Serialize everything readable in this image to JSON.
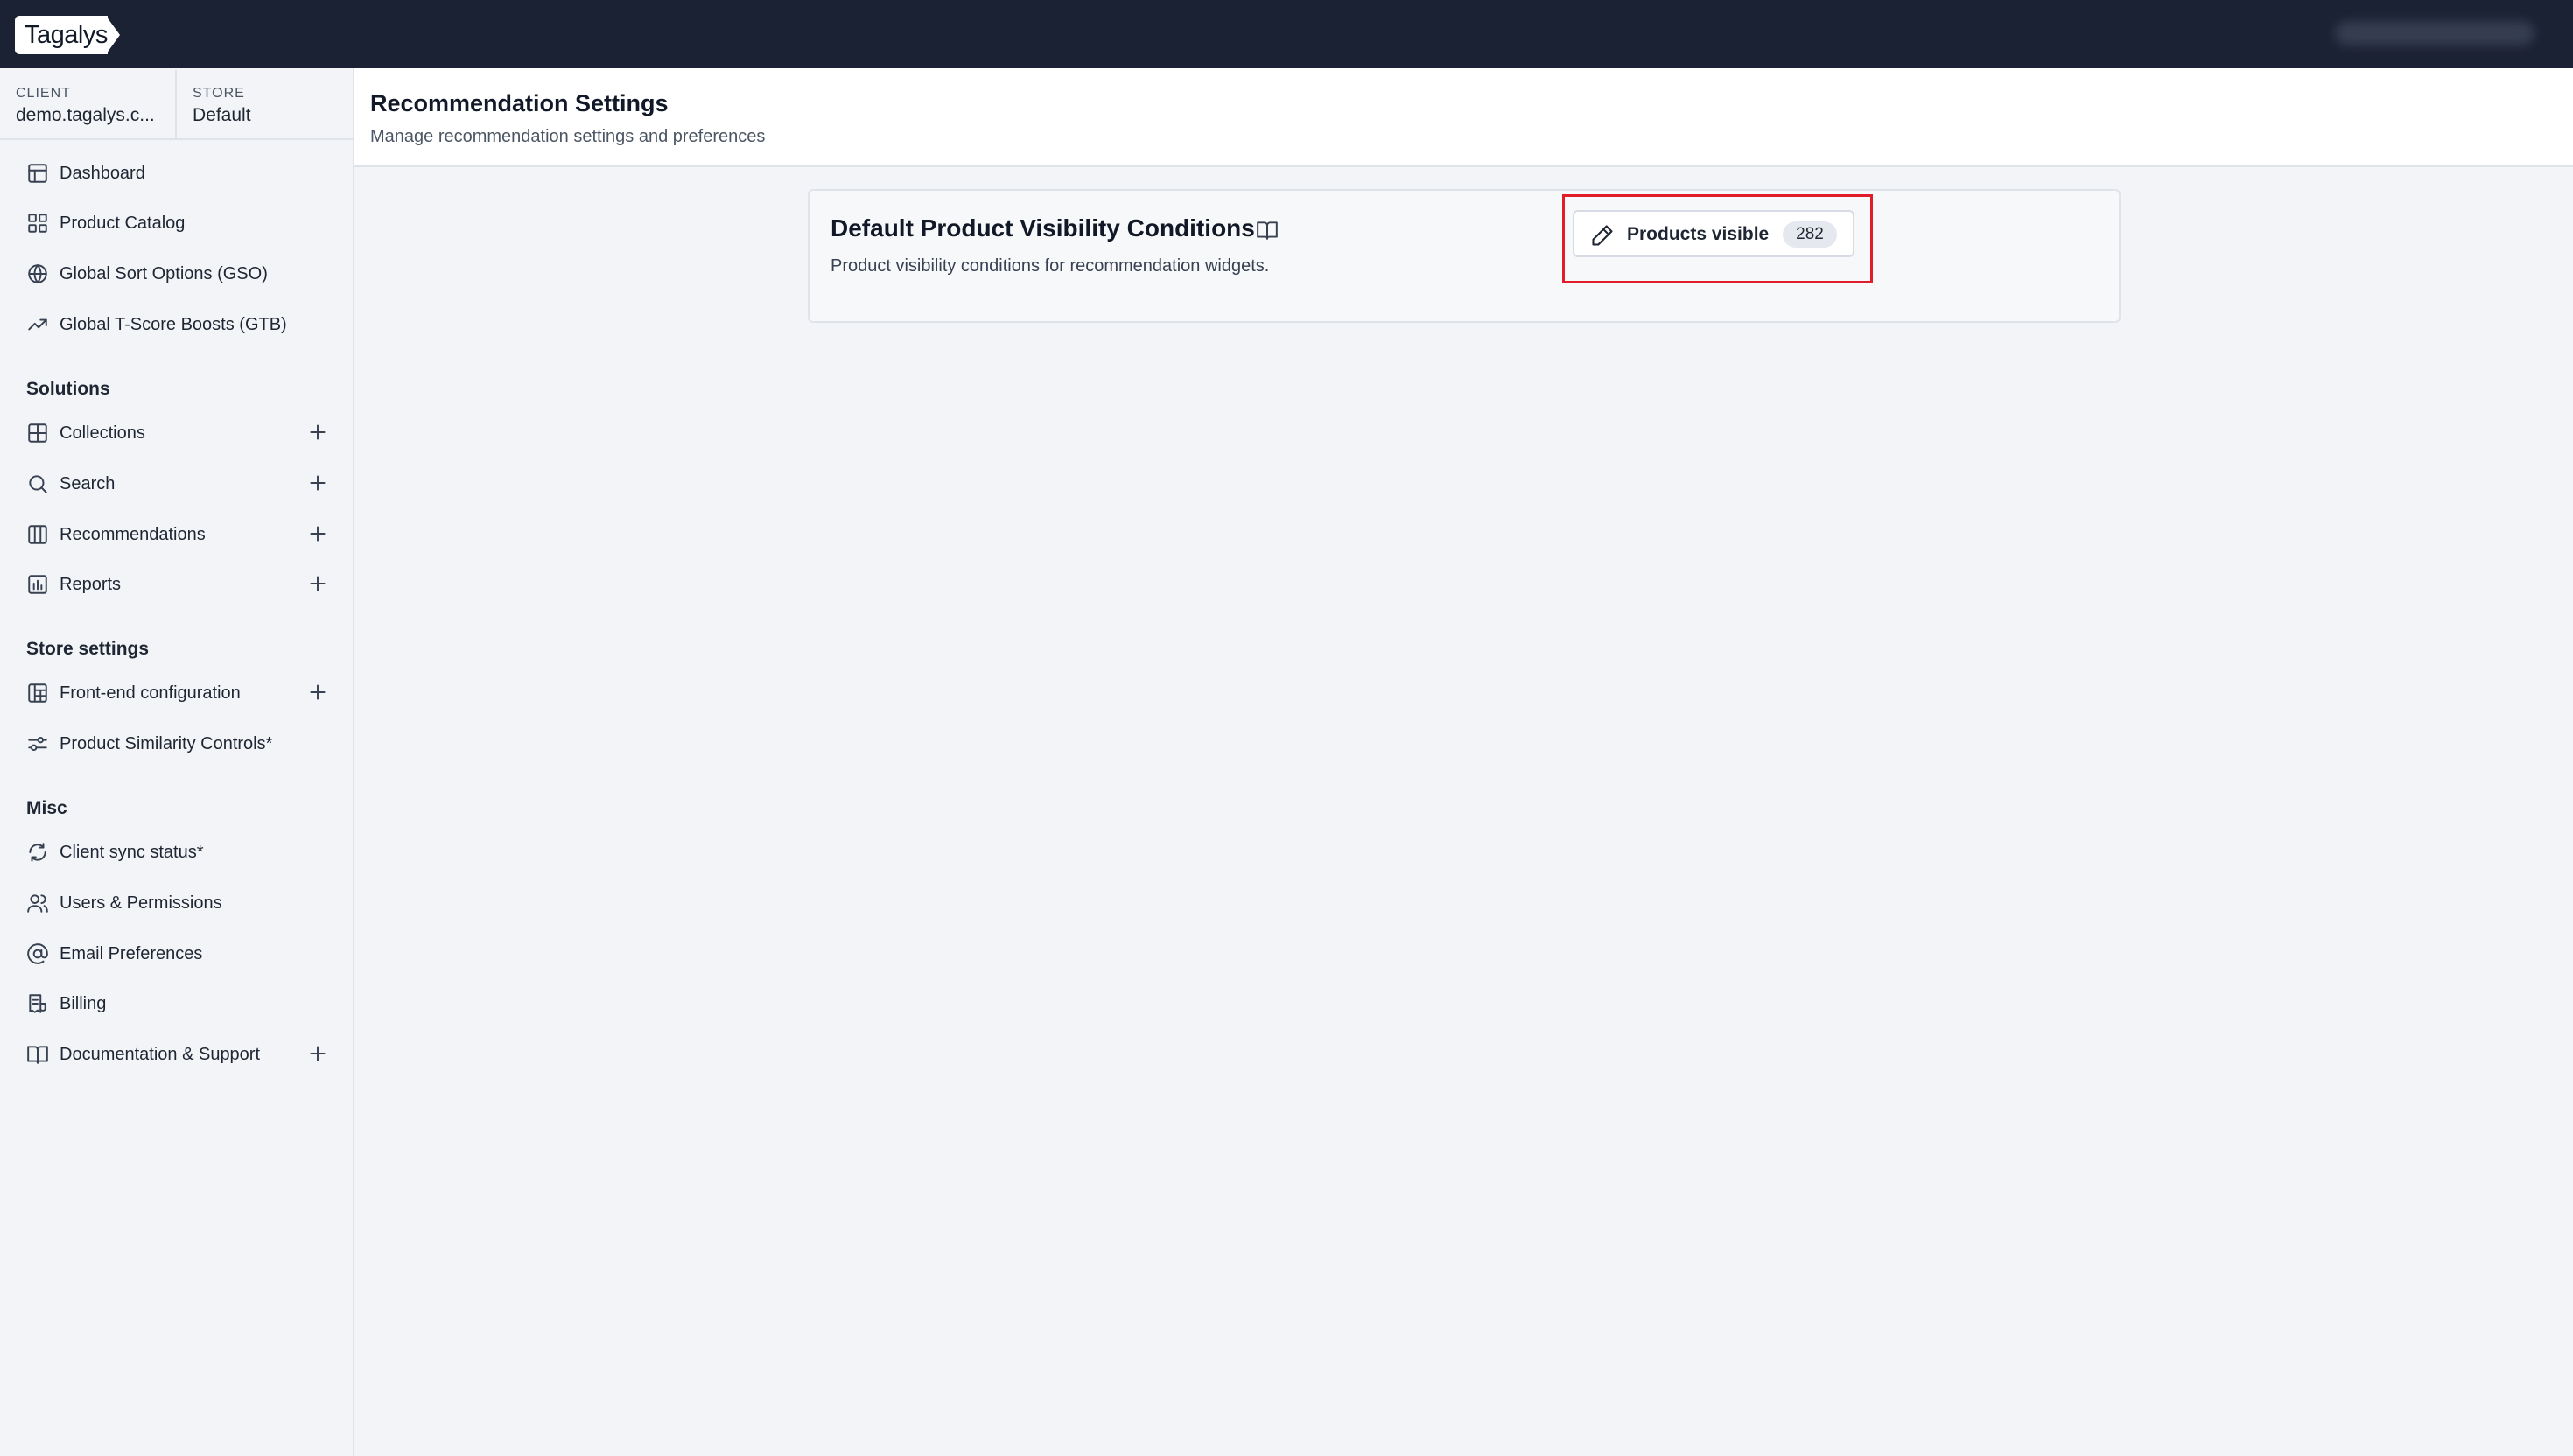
{
  "brand": {
    "logo_text": "Tagalys"
  },
  "context": {
    "client_label": "CLIENT",
    "client_value": "demo.tagalys.c...",
    "store_label": "STORE",
    "store_value": "Default"
  },
  "sidebar": {
    "main_items": [
      {
        "label": "Dashboard",
        "icon": "layout-icon"
      },
      {
        "label": "Product Catalog",
        "icon": "grid-icon"
      },
      {
        "label": "Global Sort Options (GSO)",
        "icon": "globe-icon"
      },
      {
        "label": "Global T-Score Boosts (GTB)",
        "icon": "trending-up-icon"
      }
    ],
    "solutions_heading": "Solutions",
    "solutions_items": [
      {
        "label": "Collections",
        "icon": "table-icon"
      },
      {
        "label": "Search",
        "icon": "search-icon"
      },
      {
        "label": "Recommendations",
        "icon": "columns-icon"
      },
      {
        "label": "Reports",
        "icon": "bar-chart-icon"
      }
    ],
    "store_settings_heading": "Store settings",
    "store_settings_items": [
      {
        "label": "Front-end configuration",
        "icon": "layout-grid-icon"
      },
      {
        "label": "Product Similarity Controls*",
        "icon": "sliders-icon"
      }
    ],
    "misc_heading": "Misc",
    "misc_items": [
      {
        "label": "Client sync status*",
        "icon": "refresh-icon"
      },
      {
        "label": "Users & Permissions",
        "icon": "users-icon"
      },
      {
        "label": "Email Preferences",
        "icon": "at-sign-icon"
      },
      {
        "label": "Billing",
        "icon": "receipt-icon"
      },
      {
        "label": "Documentation & Support",
        "icon": "book-icon"
      }
    ]
  },
  "header": {
    "title": "Recommendation Settings",
    "subtitle": "Manage recommendation settings and preferences"
  },
  "card": {
    "title": "Default Product Visibility Conditions",
    "description": "Product visibility conditions for recommendation widgets.",
    "button_label": "Products visible",
    "count": "282"
  },
  "colors": {
    "topbar": "#1b2233",
    "highlight": "#e11d2a",
    "background": "#f2f4f7"
  }
}
